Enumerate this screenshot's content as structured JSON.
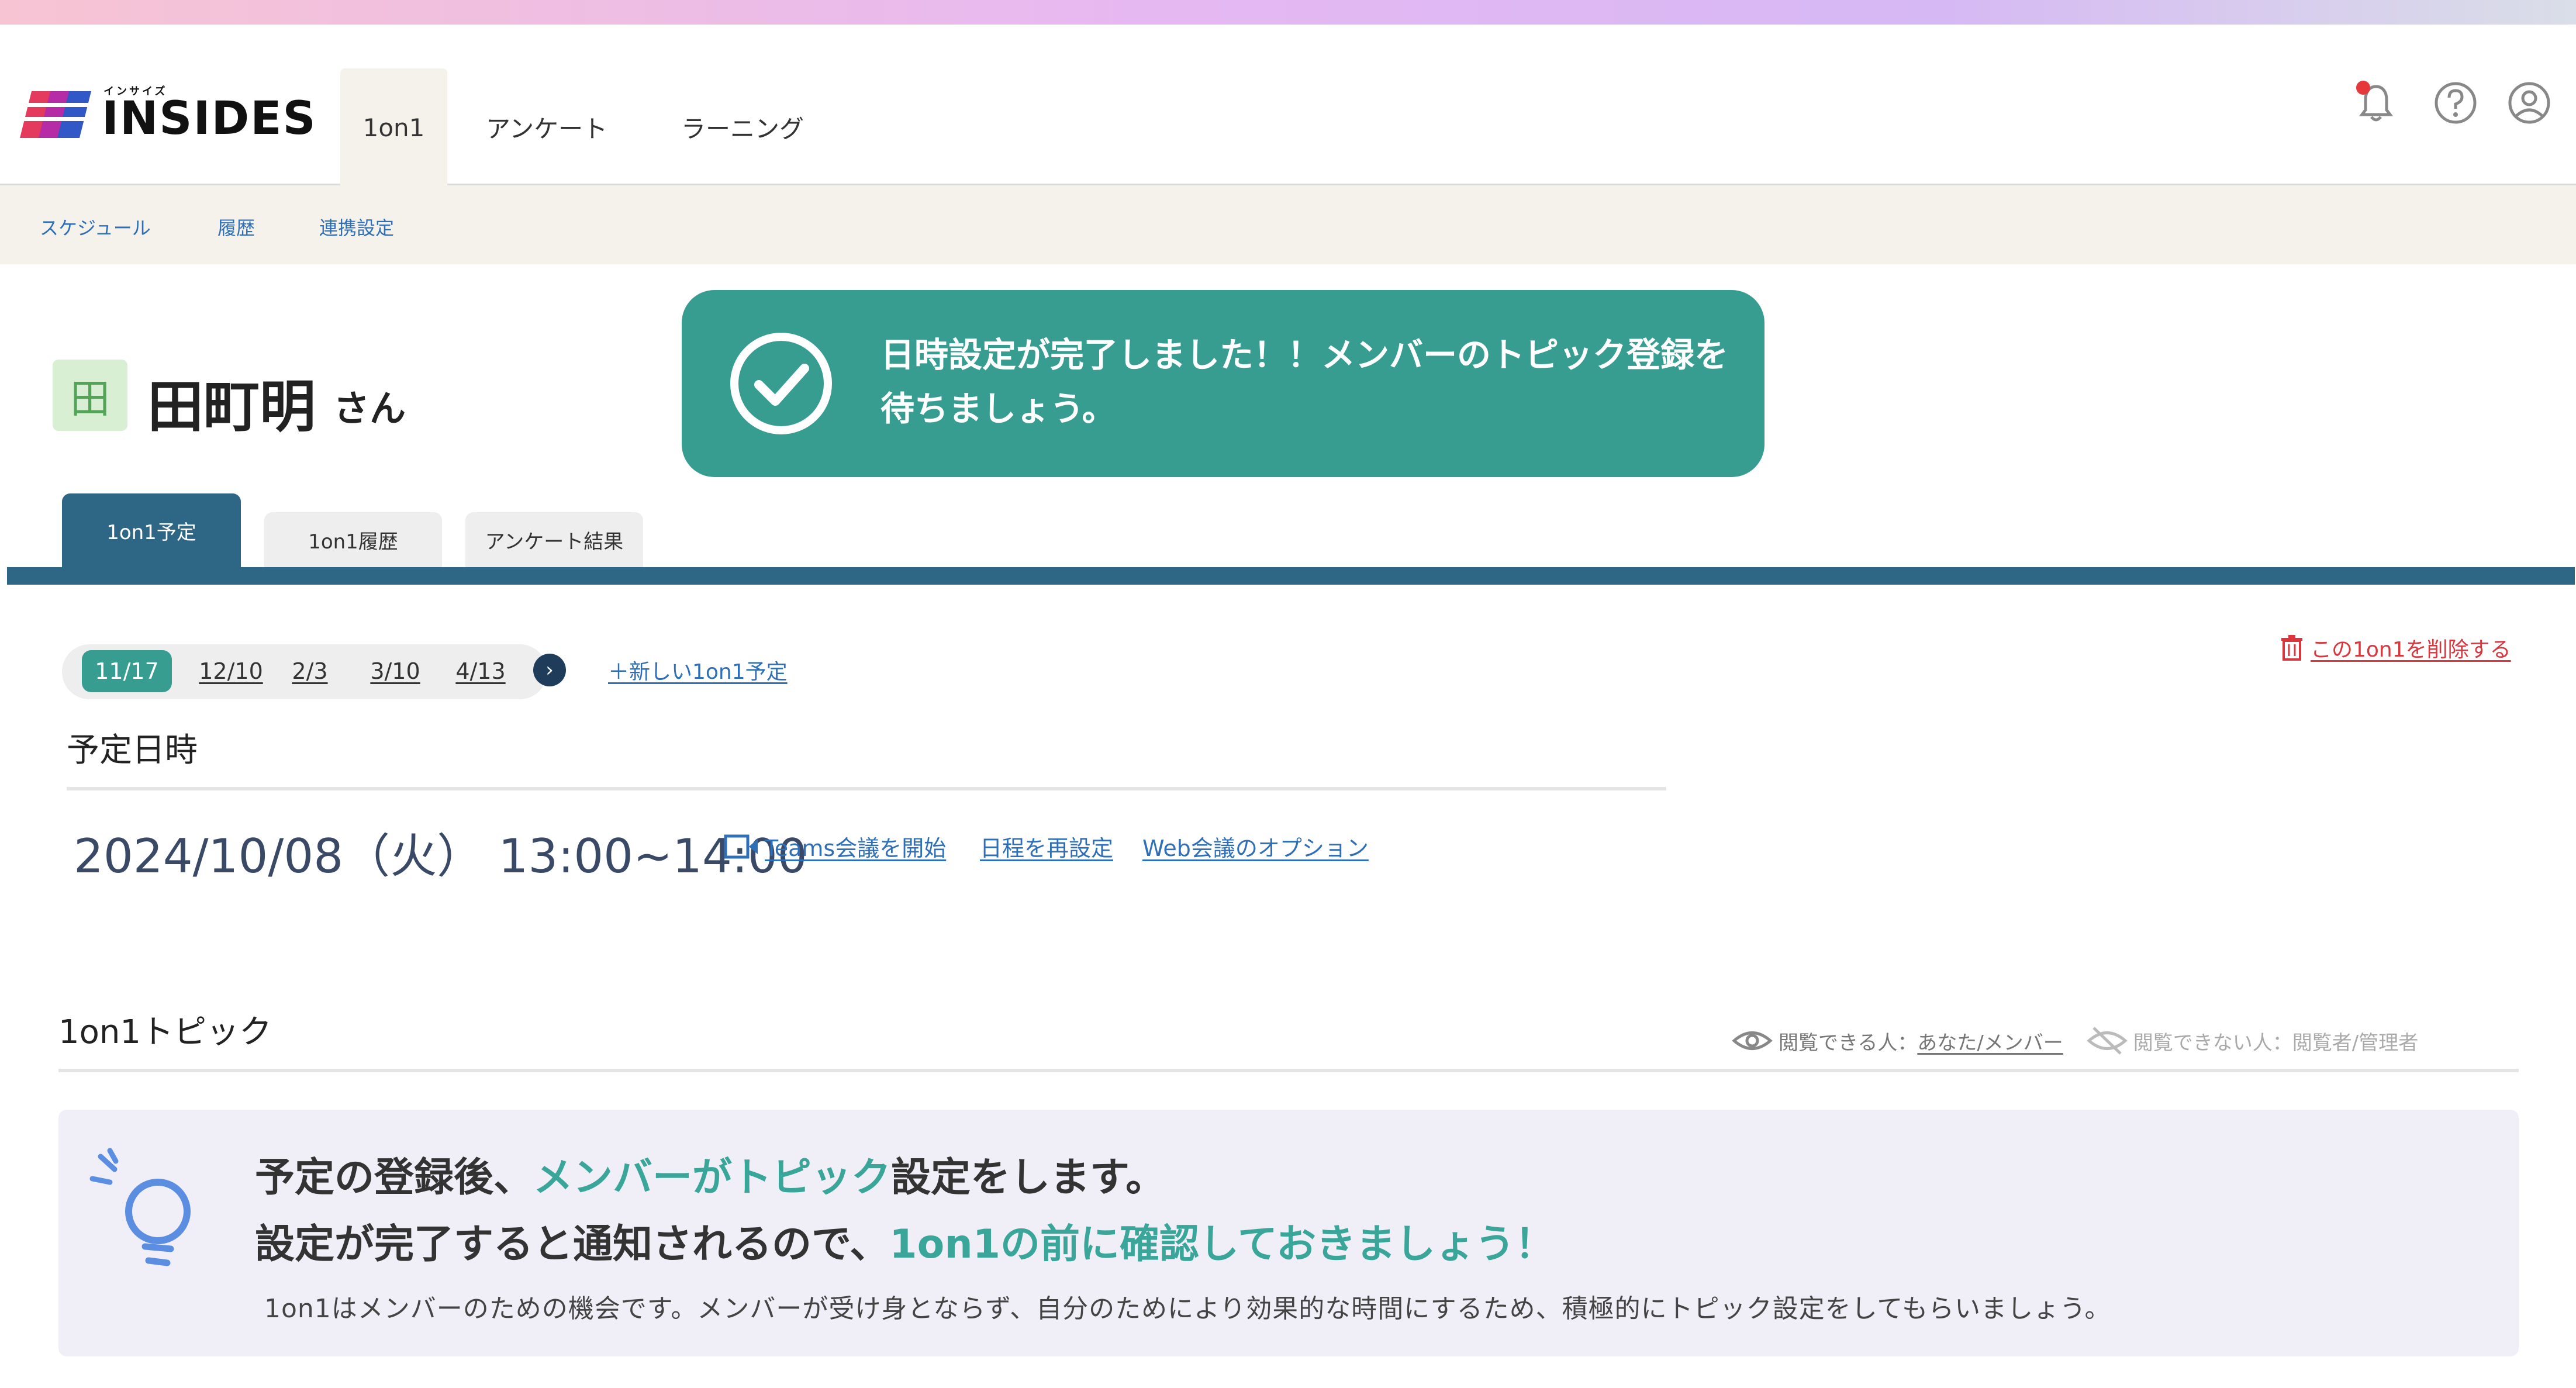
{
  "app": {
    "logo_small": "インサイズ",
    "logo_text": "INSIDES"
  },
  "nav": {
    "tabs": [
      {
        "label": "1on1",
        "active": true
      },
      {
        "label": "アンケート",
        "active": false
      },
      {
        "label": "ラーニング",
        "active": false
      }
    ],
    "icons": [
      "bell-icon",
      "help-icon",
      "account-icon"
    ],
    "notification_dot_color": "#e5383b"
  },
  "subnav": {
    "items": [
      "スケジュール",
      "履歴",
      "連携設定"
    ]
  },
  "user": {
    "avatar_char": "田",
    "name": "田町明",
    "suffix": "さん"
  },
  "toast": {
    "message": "日時設定が完了しました！！メンバーのトピック登録を待ちましょう。",
    "color": "#389d91"
  },
  "tabs": [
    {
      "label": "1on1予定",
      "active": true
    },
    {
      "label": "1on1履歴",
      "active": false
    },
    {
      "label": "アンケート結果",
      "active": false
    }
  ],
  "schedule": {
    "dates": [
      {
        "label": "11/17",
        "active": true
      },
      {
        "label": "12/10",
        "active": false
      },
      {
        "label": "2/3",
        "active": false
      },
      {
        "label": "3/10",
        "active": false
      },
      {
        "label": "4/13",
        "active": false
      }
    ],
    "new_link": "＋新しい1on1予定",
    "delete_link": "この1on1を削除する",
    "section_title": "予定日時",
    "datetime": "2024/10/08（火） 13:00~14:00",
    "teams_link": "Teams会議を開始",
    "reschedule_link": "日程を再設定",
    "web_options_link": "Web会議のオプション"
  },
  "topics": {
    "title": "1on1トピック",
    "visible_label": "閲覧できる人：",
    "visible_who": "あなた/メンバー",
    "hidden_label": "閲覧できない人：閲覧者/管理者",
    "info": {
      "line1_a": "予定の登録後、",
      "line1_b": "メンバーがトピック",
      "line1_c": "設定をします。",
      "line2_a": "設定が完了すると通知されるので、",
      "line2_b": "1on1の前に確認しておきましょう！",
      "line3": "1on1はメンバーのための機会です。メンバーが受け身とならず、自分のためにより効果的な時間にするため、積極的にトピック設定をしてもらいましょう。"
    }
  },
  "colors": {
    "accent_teal": "#3aa69a",
    "tab_blue": "#2e6686",
    "link_blue": "#2f6fb8",
    "delete_red": "#d9363e"
  }
}
